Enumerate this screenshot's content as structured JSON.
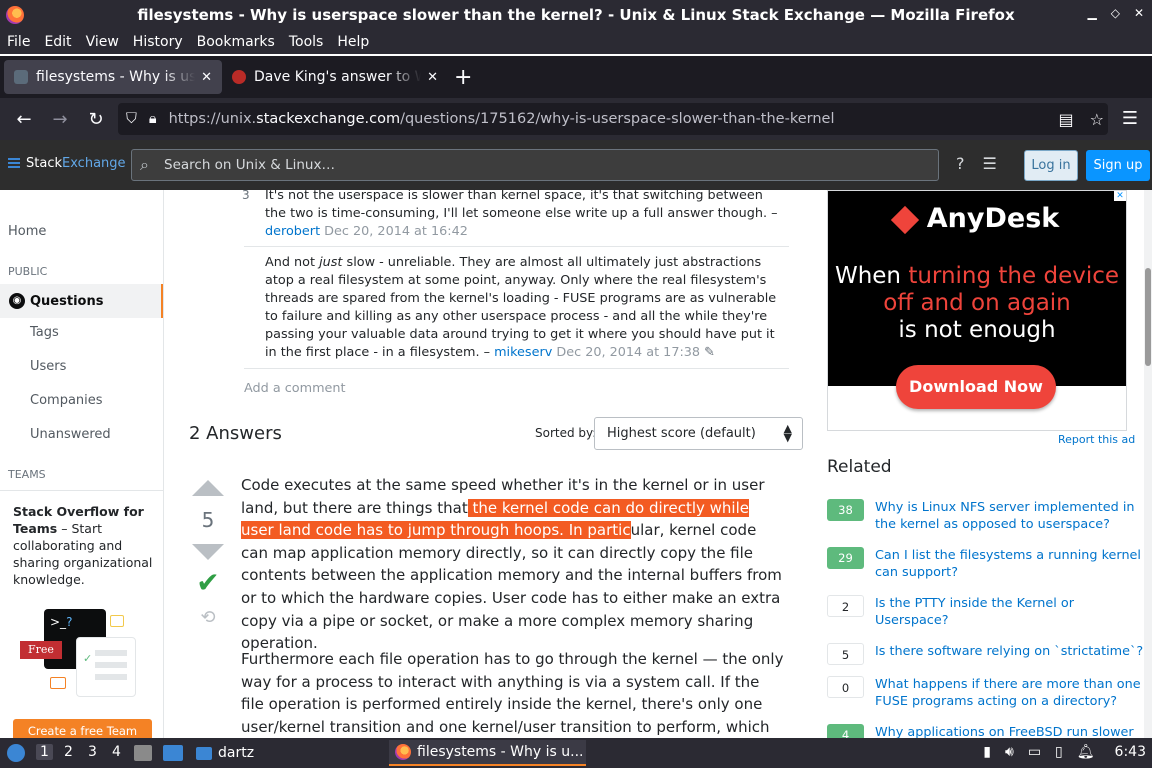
{
  "window": {
    "title": "filesystems - Why is userspace slower than the kernel? - Unix & Linux Stack Exchange — Mozilla Firefox"
  },
  "menu": [
    "File",
    "Edit",
    "View",
    "History",
    "Bookmarks",
    "Tools",
    "Help"
  ],
  "tabs": [
    {
      "label": "filesystems - Why is userspace slower than the kernel?",
      "close": "✕"
    },
    {
      "label": "Dave King's answer to Why",
      "close": "✕"
    }
  ],
  "new_tab": "+",
  "url": {
    "prefix": "https://unix.",
    "domain": "stackexchange.com",
    "path": "/questions/175162/why-is-userspace-slower-than-the-kernel"
  },
  "site": {
    "logo_a": "Stack",
    "logo_b": "Exchange",
    "search_placeholder": "Search on Unix & Linux…",
    "login": "Log in",
    "signup": "Sign up"
  },
  "leftnav": {
    "home": "Home",
    "public": "PUBLIC",
    "questions": "Questions",
    "tags": "Tags",
    "users": "Users",
    "companies": "Companies",
    "unanswered": "Unanswered",
    "teams": "TEAMS",
    "teams_title": "Stack Overflow for Teams",
    "teams_desc": " – Start collaborating and sharing organizational knowledge.",
    "free": "Free",
    "create_team": "Create a free Team"
  },
  "comments": [
    {
      "score": "3",
      "text": "It's not the userspace is slower than kernel space, it's that switching between the two is time-consuming, I'll let someone else write up a full answer though. – ",
      "user": "derobert",
      "date": "Dec 20, 2014 at 16:42"
    },
    {
      "score": "",
      "text_a": "And not ",
      "text_em": "just",
      "text_b": " slow - unreliable. They are almost all ultimately just abstractions atop a real filesystem at some point, anyway. Only where the real filesystem's threads are spared from the kernel's loading - FUSE programs are as vulnerable to failure and killing as any other userspace process - and all the while they're passing your valuable data around trying to get it where you should have put it in the first place - in a filesystem. – ",
      "user": "mikeserv",
      "date": "Dec 20, 2014 at 17:38"
    }
  ],
  "add_comment": "Add a comment",
  "answers": {
    "heading": "2 Answers",
    "sorted_by": "Sorted by:",
    "sort_value": "Highest score (default)",
    "score": "5",
    "para1_a": "Code executes at the same speed whether it's in the kernel or in user land, but there are things that",
    "para1_hl": " the kernel code can do directly while user land code has to jump through hoops. In partic",
    "para1_b": "ular, kernel code can map application memory directly, so it can directly copy the file contents between the application memory and the internal buffers from or to which the hardware copies. User code has to either make an extra copy via a pipe or socket, or make a more complex memory sharing operation.",
    "para2": "Furthermore each file operation has to go through the kernel — the only way for a process to interact with anything is via a system call. If the file operation is performed entirely inside the kernel, there's only one user/kernel transition and one kernel/user transition to perform, which is pretty fast. If the file operation is"
  },
  "ad": {
    "brand": "AnyDesk",
    "line1_a": "When ",
    "line1_b": "turning the device",
    "line2": "off and on again",
    "line3": "is not enough",
    "button": "Download Now",
    "report": "Report this ad"
  },
  "related": {
    "heading": "Related",
    "items": [
      {
        "score": "38",
        "accepted": true,
        "title": "Why is Linux NFS server implemented in the kernel as opposed to userspace?"
      },
      {
        "score": "29",
        "accepted": true,
        "title": "Can I list the filesystems a running kernel can support?"
      },
      {
        "score": "2",
        "accepted": false,
        "title": "Is the PTTY inside the Kernel or Userspace?"
      },
      {
        "score": "5",
        "accepted": false,
        "title": "Is there software relying on `strictatime`?"
      },
      {
        "score": "0",
        "accepted": false,
        "title": "What happens if there are more than one FUSE programs acting on a directory?"
      },
      {
        "score": "4",
        "accepted": true,
        "title": "Why applications on FreeBSD run slower"
      }
    ]
  },
  "taskbar": {
    "workspaces": [
      "1",
      "2",
      "3",
      "4"
    ],
    "folder": "dartz",
    "task": "filesystems - Why is u...",
    "time": "6:43"
  }
}
